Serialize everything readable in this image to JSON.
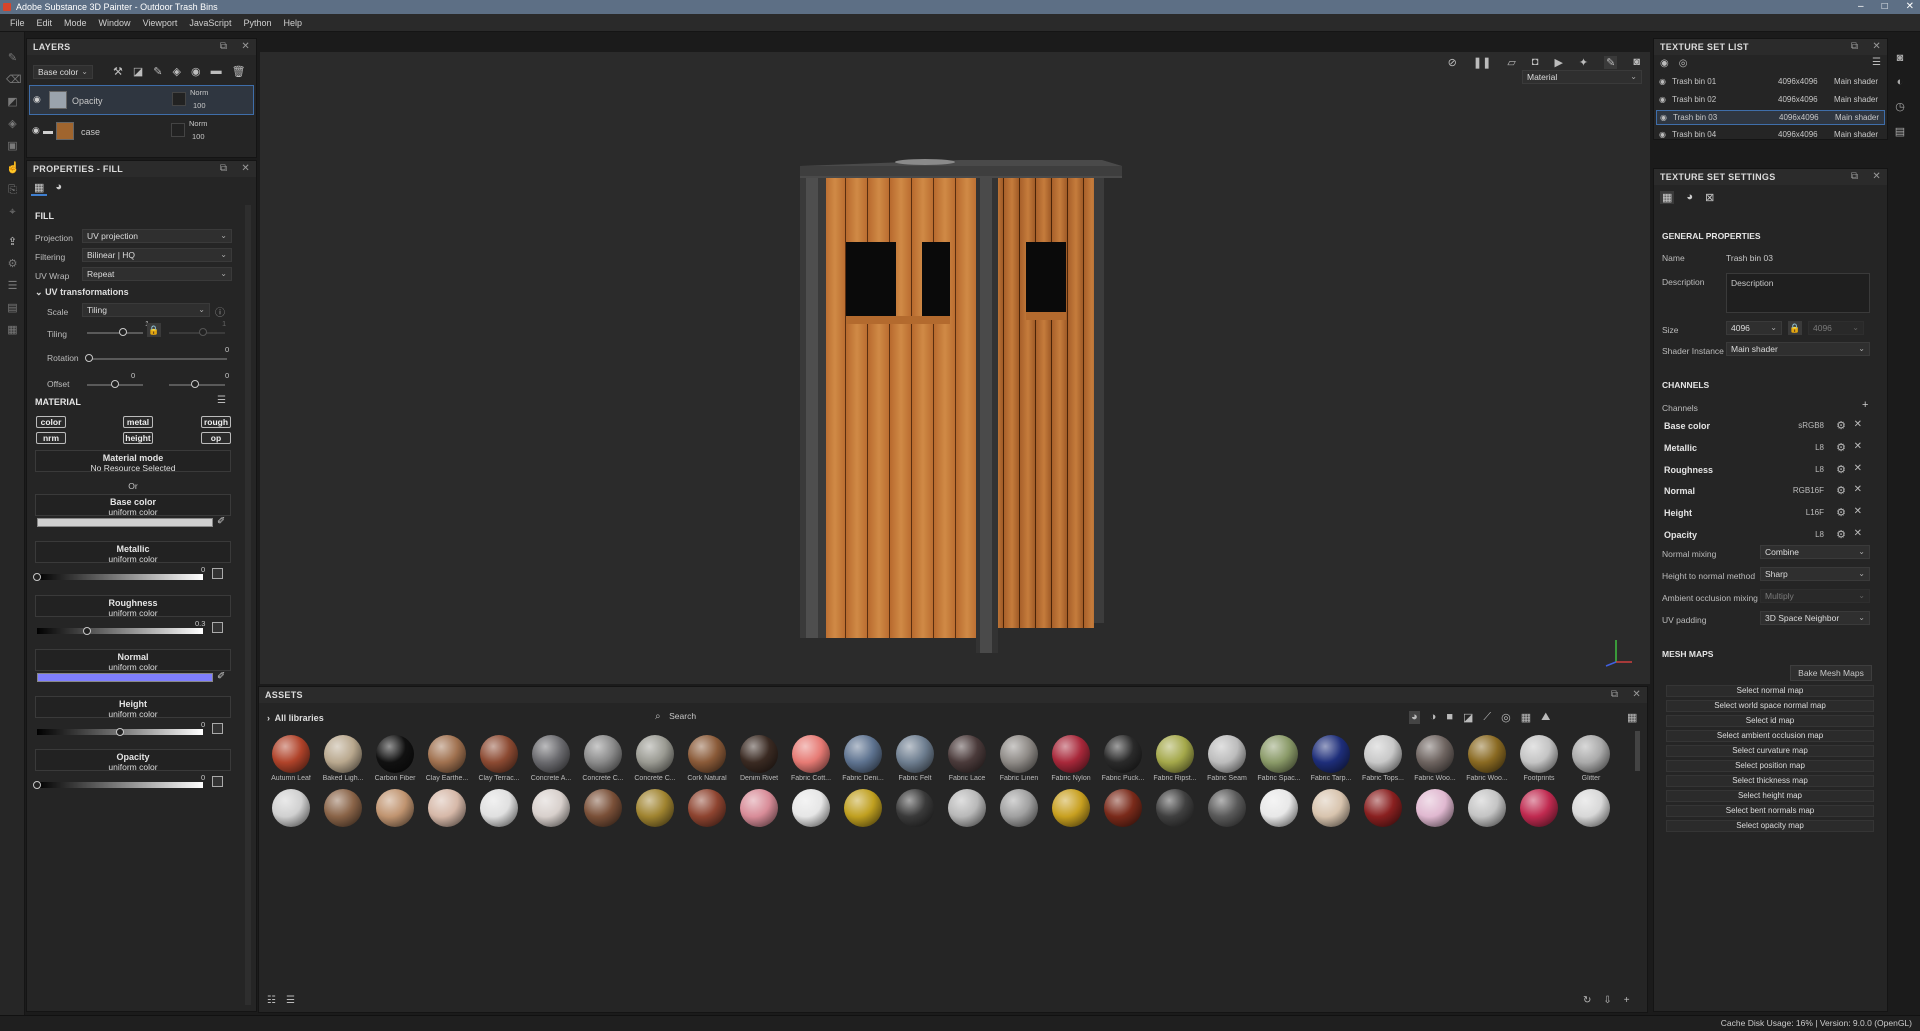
{
  "window": {
    "title": "Adobe Substance 3D Painter - Outdoor Trash Bins",
    "controls": [
      "–",
      "□",
      "✕"
    ]
  },
  "menu": [
    "File",
    "Edit",
    "Mode",
    "Window",
    "Viewport",
    "JavaScript",
    "Python",
    "Help"
  ],
  "layers": {
    "title": "LAYERS",
    "channel_select": "Base color",
    "items": [
      {
        "name": "Opacity",
        "blend": "Norm",
        "opacity": "100"
      },
      {
        "name": "case",
        "blend": "Norm",
        "opacity": "100"
      }
    ]
  },
  "properties": {
    "title": "PROPERTIES - FILL",
    "fill_label": "FILL",
    "projection_label": "Projection",
    "projection": "UV projection",
    "filtering_label": "Filtering",
    "filtering": "Bilinear | HQ",
    "uvwrap_label": "UV Wrap",
    "uvwrap": "Repeat",
    "uvt_label": "UV transformations",
    "scale_label": "Scale",
    "scale": "Tiling",
    "tiling_label": "Tiling",
    "tiling_value": "1",
    "tiling_value2": "1",
    "rotation_label": "Rotation",
    "rotation_value": "0",
    "offset_label": "Offset",
    "offset_value1": "0",
    "offset_value2": "0",
    "material_label": "MATERIAL",
    "chips": [
      "color",
      "metal",
      "rough",
      "nrm",
      "height",
      "op"
    ],
    "material_mode_title": "Material mode",
    "material_mode_value": "No Resource Selected",
    "or_label": "Or",
    "channels": [
      {
        "name": "Base color",
        "sub": "uniform color",
        "value": ""
      },
      {
        "name": "Metallic",
        "sub": "uniform color",
        "value": "0"
      },
      {
        "name": "Roughness",
        "sub": "uniform color",
        "value": "0.3"
      },
      {
        "name": "Normal",
        "sub": "uniform color",
        "value": ""
      },
      {
        "name": "Height",
        "sub": "uniform color",
        "value": "0"
      },
      {
        "name": "Opacity",
        "sub": "uniform color",
        "value": "0"
      }
    ],
    "roughness_level": 0.3,
    "base_color_swatch": "#d0d0d0",
    "normal_swatch": "#7f7fff"
  },
  "viewport": {
    "mode_select": "Material"
  },
  "texture_set_list": {
    "title": "TEXTURE SET LIST",
    "items": [
      {
        "name": "Trash bin 01",
        "size": "4096x4096",
        "shader": "Main shader"
      },
      {
        "name": "Trash bin 02",
        "size": "4096x4096",
        "shader": "Main shader"
      },
      {
        "name": "Trash bin 03",
        "size": "4096x4096",
        "shader": "Main shader"
      },
      {
        "name": "Trash bin 04",
        "size": "4096x4096",
        "shader": "Main shader"
      }
    ],
    "selected_index": 2
  },
  "texture_set_settings": {
    "title": "TEXTURE SET SETTINGS",
    "general_title": "GENERAL PROPERTIES",
    "name_label": "Name",
    "name_value": "Trash bin 03",
    "description_label": "Description",
    "description_placeholder": "Description",
    "size_label": "Size",
    "size_value": "4096",
    "size_value2": "4096",
    "shader_label": "Shader Instance",
    "shader_value": "Main shader",
    "channels_title": "CHANNELS",
    "channels_label": "Channels",
    "channels": [
      {
        "name": "Base color",
        "format": "sRGB8"
      },
      {
        "name": "Metallic",
        "format": "L8"
      },
      {
        "name": "Roughness",
        "format": "L8"
      },
      {
        "name": "Normal",
        "format": "RGB16F"
      },
      {
        "name": "Height",
        "format": "L16F"
      },
      {
        "name": "Opacity",
        "format": "L8"
      }
    ],
    "normal_mixing_label": "Normal mixing",
    "normal_mixing": "Combine",
    "h2n_label": "Height to normal method",
    "h2n": "Sharp",
    "ao_label": "Ambient occlusion mixing",
    "ao": "Multiply",
    "uvpad_label": "UV padding",
    "uvpad": "3D Space Neighbor",
    "mesh_maps_title": "MESH MAPS",
    "bake_button": "Bake Mesh Maps",
    "mesh_maps": [
      "Select normal map",
      "Select world space normal map",
      "Select id map",
      "Select ambient occlusion map",
      "Select curvature map",
      "Select position map",
      "Select thickness map",
      "Select height map",
      "Select bent normals map",
      "Select opacity map"
    ]
  },
  "assets": {
    "title": "ASSETS",
    "library": "All libraries",
    "search_placeholder": "Search",
    "row1": [
      {
        "label": "Autumn Leaf",
        "color": "#b0432a"
      },
      {
        "label": "Baked Ligh...",
        "color": "#b9a88e"
      },
      {
        "label": "Carbon Fiber",
        "color": "#111111"
      },
      {
        "label": "Clay Earthe...",
        "color": "#a0714f"
      },
      {
        "label": "Clay Terrac...",
        "color": "#8c4a32"
      },
      {
        "label": "Concrete A...",
        "color": "#6a6a6e"
      },
      {
        "label": "Concrete C...",
        "color": "#8a8a8a"
      },
      {
        "label": "Concrete C...",
        "color": "#9a9a92"
      },
      {
        "label": "Cork Natural",
        "color": "#8a5a38"
      },
      {
        "label": "Denim Rivet",
        "color": "#3a2a22"
      },
      {
        "label": "Fabric Cott...",
        "color": "#e67a74"
      },
      {
        "label": "Fabric Deni...",
        "color": "#5e7390"
      },
      {
        "label": "Fabric Felt",
        "color": "#6e7e90"
      },
      {
        "label": "Fabric Lace",
        "color": "#4a3a3a"
      },
      {
        "label": "Fabric Linen",
        "color": "#8e8a86"
      },
      {
        "label": "Fabric Nylon",
        "color": "#a8283a"
      },
      {
        "label": "Fabric Puck...",
        "color": "#2a2a2a"
      },
      {
        "label": "Fabric Ripst...",
        "color": "#a4a84a"
      },
      {
        "label": "Fabric Seam",
        "color": "#bcbcbc"
      },
      {
        "label": "Fabric Spac...",
        "color": "#8a9a68"
      },
      {
        "label": "Fabric Tarp...",
        "color": "#1e2e7a"
      },
      {
        "label": "Fabric Tops...",
        "color": "#c8c8c8"
      },
      {
        "label": "Fabric Woo...",
        "color": "#6e6460"
      },
      {
        "label": "Fabric Woo...",
        "color": "#8a6a22"
      },
      {
        "label": "Footprints",
        "color": "#c4c4c4"
      },
      {
        "label": "Glitter",
        "color": "#aaaaaa"
      }
    ],
    "row2": [
      "#d0d0d0",
      "#8a6448",
      "#c09470",
      "#d6b8a8",
      "#e0e0e0",
      "#d8d0cc",
      "#7a5038",
      "#a08430",
      "#8e4430",
      "#d88c98",
      "#e6e6e6",
      "#c0a020",
      "#3a3a3a",
      "#b8b8b8",
      "#a0a0a0",
      "#c8a020",
      "#7a2a1a",
      "#404040",
      "#5a5a5a",
      "#e8e8e8",
      "#d8c4ae",
      "#8a2020",
      "#e0b8d0",
      "#c4c4c4",
      "#c02a50",
      "#d8d8d8"
    ]
  },
  "status": {
    "text": "Cache Disk Usage:   16% | Version: 9.0.0 (OpenGL)"
  }
}
